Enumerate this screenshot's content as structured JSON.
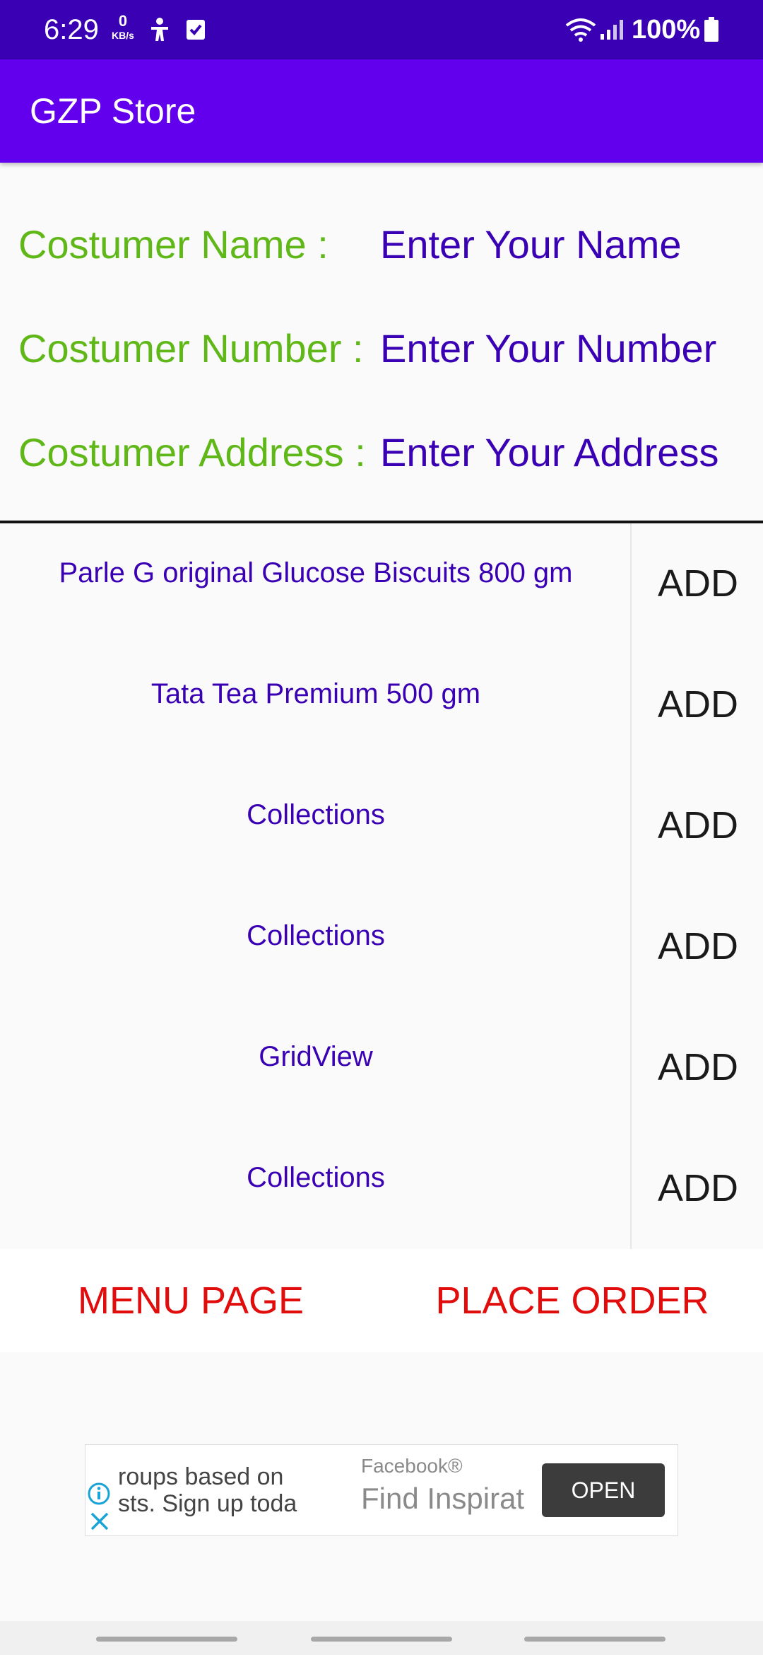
{
  "status_bar": {
    "time": "6:29",
    "net_speed_value": "0",
    "net_speed_unit": "KB/s",
    "battery": "100%"
  },
  "app_bar": {
    "title": "GZP Store"
  },
  "form": {
    "name_label": "Costumer Name :",
    "name_placeholder": "Enter Your Name",
    "number_label": "Costumer Number :",
    "number_placeholder": "Enter Your Number",
    "address_label": "Costumer Address :",
    "address_placeholder": "Enter Your Address"
  },
  "products": [
    {
      "name": "Parle G original Glucose Biscuits 800 gm",
      "action": "ADD"
    },
    {
      "name": "Tata Tea Premium 500 gm",
      "action": "ADD"
    },
    {
      "name": "Collections",
      "action": "ADD"
    },
    {
      "name": "Collections",
      "action": "ADD"
    },
    {
      "name": "GridView",
      "action": "ADD"
    },
    {
      "name": "Collections",
      "action": "ADD"
    }
  ],
  "buttons": {
    "menu_page": "MENU PAGE",
    "place_order": "PLACE ORDER"
  },
  "ad": {
    "body_line1": "roups based on",
    "body_line2": "sts. Sign up toda",
    "sponsor": "Facebook®",
    "headline": "Find Inspirat",
    "cta": "OPEN"
  },
  "colors": {
    "status_bar": "#3a00b4",
    "app_bar": "#6200ee",
    "label_green": "#5fb718",
    "input_purple": "#3a00b4",
    "button_red": "#e10d0d"
  }
}
